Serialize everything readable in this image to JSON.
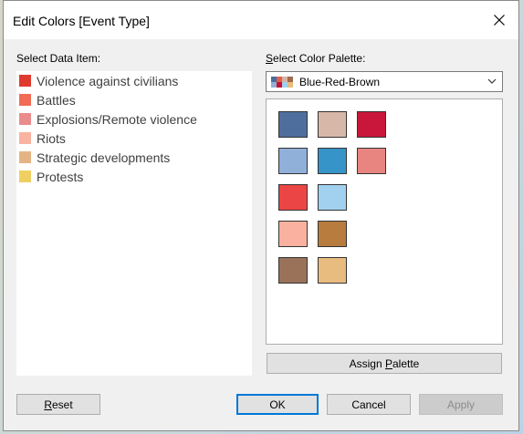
{
  "dialog": {
    "title": "Edit Colors [Event Type]",
    "select_data_item_label": "Select Data Item:",
    "select_palette_label": "Select Color Palette:"
  },
  "data_items": [
    {
      "label": "Violence against civilians",
      "color": "#e03a2e"
    },
    {
      "label": "Battles",
      "color": "#f26b55"
    },
    {
      "label": "Explosions/Remote violence",
      "color": "#ea8c8c"
    },
    {
      "label": "Riots",
      "color": "#f8b3a1"
    },
    {
      "label": "Strategic developments",
      "color": "#e5b484"
    },
    {
      "label": "Protests",
      "color": "#f0cf62"
    }
  ],
  "palette": {
    "selected": "Blue-Red-Brown",
    "thumb_colors": [
      "#4a6d9b",
      "#e06050",
      "#d6b4a3",
      "#a06c50",
      "#90b0d8",
      "#c8102e",
      "#a0d0ee",
      "#e8bc7e"
    ],
    "swatches": [
      "#4e6f9d",
      "#d7b8a8",
      "#c8173a",
      "#91b0d9",
      "#3794c8",
      "#e88580",
      "#ec4545",
      "#a1d1ef",
      "#fbb1a0",
      "#b87c3e",
      "#9a725a",
      "#e8bb7f"
    ]
  },
  "buttons": {
    "assign_palette": "Assign Palette",
    "reset": "Reset",
    "ok": "OK",
    "cancel": "Cancel",
    "apply": "Apply"
  }
}
